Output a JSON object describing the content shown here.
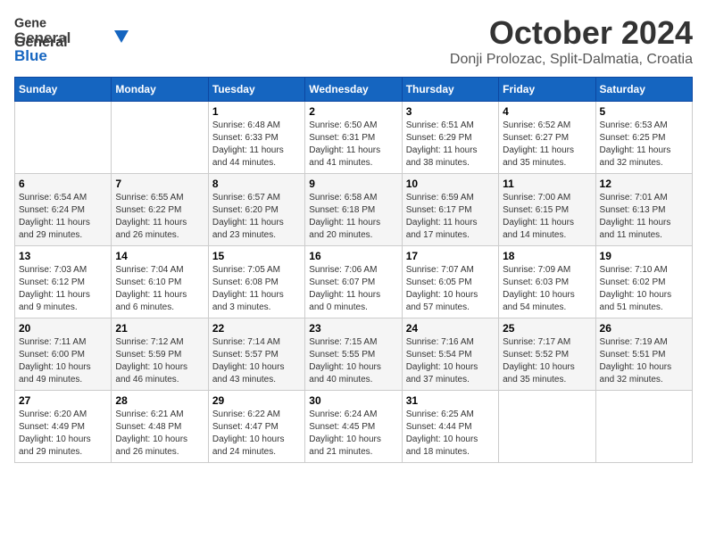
{
  "header": {
    "logo_general": "General",
    "logo_blue": "Blue",
    "month_title": "October 2024",
    "location": "Donji Prolozac, Split-Dalmatia, Croatia"
  },
  "weekdays": [
    "Sunday",
    "Monday",
    "Tuesday",
    "Wednesday",
    "Thursday",
    "Friday",
    "Saturday"
  ],
  "weeks": [
    [
      {
        "day": "",
        "info": ""
      },
      {
        "day": "",
        "info": ""
      },
      {
        "day": "1",
        "info": "Sunrise: 6:48 AM\nSunset: 6:33 PM\nDaylight: 11 hours\nand 44 minutes."
      },
      {
        "day": "2",
        "info": "Sunrise: 6:50 AM\nSunset: 6:31 PM\nDaylight: 11 hours\nand 41 minutes."
      },
      {
        "day": "3",
        "info": "Sunrise: 6:51 AM\nSunset: 6:29 PM\nDaylight: 11 hours\nand 38 minutes."
      },
      {
        "day": "4",
        "info": "Sunrise: 6:52 AM\nSunset: 6:27 PM\nDaylight: 11 hours\nand 35 minutes."
      },
      {
        "day": "5",
        "info": "Sunrise: 6:53 AM\nSunset: 6:25 PM\nDaylight: 11 hours\nand 32 minutes."
      }
    ],
    [
      {
        "day": "6",
        "info": "Sunrise: 6:54 AM\nSunset: 6:24 PM\nDaylight: 11 hours\nand 29 minutes."
      },
      {
        "day": "7",
        "info": "Sunrise: 6:55 AM\nSunset: 6:22 PM\nDaylight: 11 hours\nand 26 minutes."
      },
      {
        "day": "8",
        "info": "Sunrise: 6:57 AM\nSunset: 6:20 PM\nDaylight: 11 hours\nand 23 minutes."
      },
      {
        "day": "9",
        "info": "Sunrise: 6:58 AM\nSunset: 6:18 PM\nDaylight: 11 hours\nand 20 minutes."
      },
      {
        "day": "10",
        "info": "Sunrise: 6:59 AM\nSunset: 6:17 PM\nDaylight: 11 hours\nand 17 minutes."
      },
      {
        "day": "11",
        "info": "Sunrise: 7:00 AM\nSunset: 6:15 PM\nDaylight: 11 hours\nand 14 minutes."
      },
      {
        "day": "12",
        "info": "Sunrise: 7:01 AM\nSunset: 6:13 PM\nDaylight: 11 hours\nand 11 minutes."
      }
    ],
    [
      {
        "day": "13",
        "info": "Sunrise: 7:03 AM\nSunset: 6:12 PM\nDaylight: 11 hours\nand 9 minutes."
      },
      {
        "day": "14",
        "info": "Sunrise: 7:04 AM\nSunset: 6:10 PM\nDaylight: 11 hours\nand 6 minutes."
      },
      {
        "day": "15",
        "info": "Sunrise: 7:05 AM\nSunset: 6:08 PM\nDaylight: 11 hours\nand 3 minutes."
      },
      {
        "day": "16",
        "info": "Sunrise: 7:06 AM\nSunset: 6:07 PM\nDaylight: 11 hours\nand 0 minutes."
      },
      {
        "day": "17",
        "info": "Sunrise: 7:07 AM\nSunset: 6:05 PM\nDaylight: 10 hours\nand 57 minutes."
      },
      {
        "day": "18",
        "info": "Sunrise: 7:09 AM\nSunset: 6:03 PM\nDaylight: 10 hours\nand 54 minutes."
      },
      {
        "day": "19",
        "info": "Sunrise: 7:10 AM\nSunset: 6:02 PM\nDaylight: 10 hours\nand 51 minutes."
      }
    ],
    [
      {
        "day": "20",
        "info": "Sunrise: 7:11 AM\nSunset: 6:00 PM\nDaylight: 10 hours\nand 49 minutes."
      },
      {
        "day": "21",
        "info": "Sunrise: 7:12 AM\nSunset: 5:59 PM\nDaylight: 10 hours\nand 46 minutes."
      },
      {
        "day": "22",
        "info": "Sunrise: 7:14 AM\nSunset: 5:57 PM\nDaylight: 10 hours\nand 43 minutes."
      },
      {
        "day": "23",
        "info": "Sunrise: 7:15 AM\nSunset: 5:55 PM\nDaylight: 10 hours\nand 40 minutes."
      },
      {
        "day": "24",
        "info": "Sunrise: 7:16 AM\nSunset: 5:54 PM\nDaylight: 10 hours\nand 37 minutes."
      },
      {
        "day": "25",
        "info": "Sunrise: 7:17 AM\nSunset: 5:52 PM\nDaylight: 10 hours\nand 35 minutes."
      },
      {
        "day": "26",
        "info": "Sunrise: 7:19 AM\nSunset: 5:51 PM\nDaylight: 10 hours\nand 32 minutes."
      }
    ],
    [
      {
        "day": "27",
        "info": "Sunrise: 6:20 AM\nSunset: 4:49 PM\nDaylight: 10 hours\nand 29 minutes."
      },
      {
        "day": "28",
        "info": "Sunrise: 6:21 AM\nSunset: 4:48 PM\nDaylight: 10 hours\nand 26 minutes."
      },
      {
        "day": "29",
        "info": "Sunrise: 6:22 AM\nSunset: 4:47 PM\nDaylight: 10 hours\nand 24 minutes."
      },
      {
        "day": "30",
        "info": "Sunrise: 6:24 AM\nSunset: 4:45 PM\nDaylight: 10 hours\nand 21 minutes."
      },
      {
        "day": "31",
        "info": "Sunrise: 6:25 AM\nSunset: 4:44 PM\nDaylight: 10 hours\nand 18 minutes."
      },
      {
        "day": "",
        "info": ""
      },
      {
        "day": "",
        "info": ""
      }
    ]
  ]
}
